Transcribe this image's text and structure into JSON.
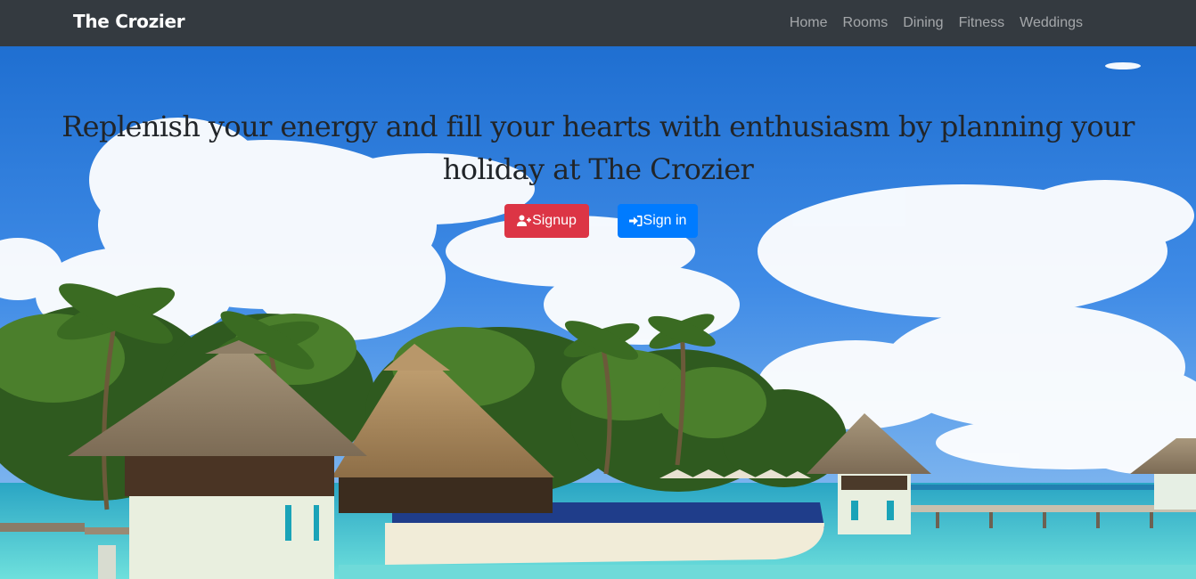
{
  "navbar": {
    "brand": "The Crozier",
    "links": [
      "Home",
      "Rooms",
      "Dining",
      "Fitness",
      "Weddings"
    ]
  },
  "hero": {
    "headline": "Replenish your energy and fill your hearts with enthusiasm by planning your holiday at The Crozier",
    "signup_label": "Signup",
    "signin_label": "Sign in",
    "signup_icon": "user-plus-icon",
    "signin_icon": "sign-in-icon",
    "background": "tropical-resort-photo"
  },
  "colors": {
    "navbar_bg": "#343a40",
    "signup_bg": "#dc3545",
    "signin_bg": "#007bff"
  }
}
